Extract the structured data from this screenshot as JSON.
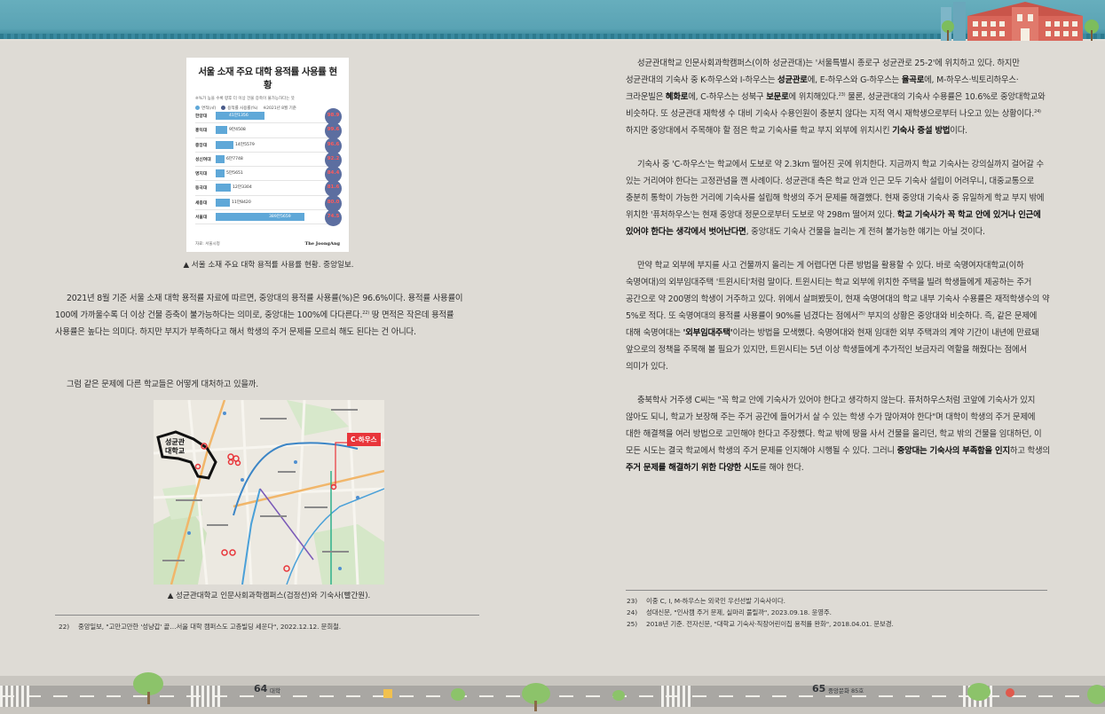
{
  "infographic": {
    "title": "서울 소재 주요 대학 용적률 사용률 현황",
    "subtitle": "※%가 높을 수록 향후 더 이상 건물 증축이 불가능하다는 뜻",
    "legend": [
      "면적(㎡)",
      "용적률 사용률(%)",
      "※2021년 8월 기준"
    ],
    "rows": [
      {
        "name": "한양대",
        "area": "41만1356",
        "rate": "98.9",
        "bar_fraction": 0.55
      },
      {
        "name": "홍익대",
        "area": "9만4508",
        "rate": "99.6",
        "bar_fraction": 0.13
      },
      {
        "name": "중앙대",
        "area": "14만5579",
        "rate": "96.6",
        "bar_fraction": 0.2
      },
      {
        "name": "성신여대",
        "area": "6만7748",
        "rate": "92.2",
        "bar_fraction": 0.09
      },
      {
        "name": "명지대",
        "area": "5만5651",
        "rate": "84.4",
        "bar_fraction": 0.08
      },
      {
        "name": "동국대",
        "area": "12만3304",
        "rate": "81.6",
        "bar_fraction": 0.17
      },
      {
        "name": "세종대",
        "area": "11만8420",
        "rate": "80.0",
        "bar_fraction": 0.16
      },
      {
        "name": "서울대",
        "area": "389만5659",
        "rate": "74.5",
        "bar_fraction": 1.0
      }
    ],
    "source": "자료: 서울시청",
    "brand": "The JoongAng"
  },
  "left": {
    "caption1": "▲ 서울 소재 주요 대학 용적률 사용률 현황. 중앙일보.",
    "para1_a": "2021년 8월 기준 서울 소재 대학 용적률 자료에 따르면, 중앙대의 용적률 사용률(%)은 96.6%이다. 용적률 사용률이 100에 가까울수록 더 이상 건물 증축이 불가능하다는 의미로, 중앙대는 100%에 다다른다.",
    "para1_sup": "22)",
    "para1_b": " 땅 면적은 작은데 용적률 사용률은 높다는 의미다. 하지만 부지가 부족하다고 해서 학생의 주거 문제를 모르쇠 해도 된다는 건 아니다.",
    "para2": "그럼 같은 문제에 다른 학교들은 어떻게 대처하고 있을까.",
    "map_label": "성균관\n대학교",
    "map_tag": "C-하우스",
    "caption2": "▲ 성균관대학교 인문사회과학캠퍼스(검정선)와 기숙사(빨간원).",
    "footnote": {
      "num": "22)",
      "text": "중앙일보, \"고만고만한 '성냥갑' 끝…서울 대학 캠퍼스도 고층빌딩 세운다\", 2022.12.12. 문희철."
    }
  },
  "right": {
    "p1": [
      {
        "t": "성균관대학교 인문사회과학캠퍼스(이하 성균관대)는 '서울특별시 종로구 성균관로 25-2'에 위치하고 있다. 하지만 성균관대의 기숙사 중 K-하우스와 I-하우스는 "
      },
      {
        "t": "성균관로",
        "b": true
      },
      {
        "t": "에, E-하우스와 G-하우스는 "
      },
      {
        "t": "율곡로",
        "b": true
      },
      {
        "t": "에, M-하우스·빅토리하우스·크라운빌은 "
      },
      {
        "t": "혜화로",
        "b": true
      },
      {
        "t": "에, C-하우스는 성북구 "
      },
      {
        "t": "보문로",
        "b": true
      },
      {
        "t": "에 위치해있다."
      },
      {
        "t": "23)",
        "sup": true
      },
      {
        "t": " 물론, 성균관대의 기숙사 수용률은 10.6%로 중앙대학교와 비슷하다. 또 성균관대 재학생 수 대비 기숙사 수용인원이 충분치 않다는 지적 역시 재학생으로부터 나오고 있는 상황이다."
      },
      {
        "t": "24)",
        "sup": true
      },
      {
        "t": " 하지만 중앙대에서 주목해야 할 점은 학교 기숙사를 학교 부지 외부에 위치시킨 "
      },
      {
        "t": "기숙사 증설 방법",
        "b": true
      },
      {
        "t": "이다."
      }
    ],
    "p2": [
      {
        "t": "기숙사 중 'C-하우스'는 학교에서 도보로 약 2.3km 떨어진 곳에 위치한다. 지금까지 학교 기숙사는 강의실까지 걸어갈 수 있는 거리여야 한다는 고정관념을 깬 사례이다. 성균관대 측은 학교 안과 인근 모두 기숙사 설립이 어려우니, 대중교통으로 충분히 통학이 가능한 거리에 기숙사를 설립해 학생의 주거 문제를 해결했다. 현재 중앙대 기숙사 중 유일하게 학교 부지 밖에 위치한 '퓨처하우스'는 현재 중앙대 정문으로부터 도보로 약 298m 떨어져 있다. "
      },
      {
        "t": "학교 기숙사가 꼭 학교 안에 있거나 인근에 있어야 한다는 생각에서 벗어난다면",
        "b": true
      },
      {
        "t": ", 중앙대도 기숙사 건물을 늘리는 게 전혀 불가능한 얘기는 아닐 것이다."
      }
    ],
    "p3": [
      {
        "t": "만약 학교 외부에 부지를 사고 건물까지 올리는 게 어렵다면 다른 방법을 활용할 수 있다. 바로 숙명여자대학교(이하 숙명여대)의 외부임대주택 '트윈시티'처럼 말이다. 트윈시티는 학교 외부에 위치한 주택을 빌려 학생들에게 제공하는 주거 공간으로 약 200명의 학생이 거주하고 있다. 위에서 살펴봤듯이, 현재 숙명여대의 학교 내부 기숙사 수용률은 재적학생수의 약 5%로 적다. 또 숙명여대의 용적률 사용률이 90%를 넘겼다는 점에서"
      },
      {
        "t": "25)",
        "sup": true
      },
      {
        "t": " 부지의 상황은 중앙대와 비슷하다. 즉, 같은 문제에 대해 숙명여대는 "
      },
      {
        "t": "'외부임대주택'",
        "b": true
      },
      {
        "t": "이라는 방법을 모색했다. 숙명여대와 현재 임대한 외부 주택과의 계약 기간이 내년에 만료돼 앞으로의 정책을 주목해 볼 필요가 있지만, 트윈시티는 5년 이상 학생들에게 추가적인 보금자리 역할을 해줬다는 점에서 의미가 있다."
      }
    ],
    "p4": [
      {
        "t": "충북학사 거주생 C씨는 \"꼭 학교 안에 기숙사가 있어야 한다고 생각하지 않는다. 퓨처하우스처럼 코앞에 기숙사가 있지 않아도 되니, 학교가 보장해 주는 주거 공간에 들어가서 살 수 있는 학생 수가 많아져야 한다\"며 대학이 학생의 주거 문제에 대한 해결책을 여러 방법으로 고민해야 한다고 주장했다. 학교 밖에 땅을 사서 건물을 올리던, 학교 밖의 건물을 임대하던, 이 모든 시도는 결국 학교에서 학생의 주거 문제를 인지해야 시행될 수 있다. 그러니 "
      },
      {
        "t": "중앙대는 기숙사의 부족함을 인지",
        "b": true
      },
      {
        "t": "하고 학생의 "
      },
      {
        "t": "주거 문제를 해결하기 위한 다양한 시도",
        "b": true
      },
      {
        "t": "를 해야 한다."
      }
    ],
    "footnotes": [
      {
        "num": "23)",
        "text": "이중 C, I, M-하우스는 외국인 우선선발 기숙사이다."
      },
      {
        "num": "24)",
        "text": "성대신문, \"인사캠 주거 문제, 실마리 풀릴까\", 2023.09.18. 윤영주."
      },
      {
        "num": "25)",
        "text": "2018년 기준. 전자신문, \"대학교 기숙사·직장어린이집 용적률 완화\", 2018.04.01. 문보경."
      }
    ]
  },
  "footer": {
    "left_num": "64",
    "left_tag": "대학",
    "right_num": "65",
    "right_tag": "중앙문화 85호"
  },
  "colors": {
    "background": "#dedbd5",
    "banner": "#5aa3b4",
    "bar": "#5fa8d8",
    "circle": "#5c6ea0",
    "rate_text": "#ff5a5a",
    "map_tag": "#e8353a"
  }
}
